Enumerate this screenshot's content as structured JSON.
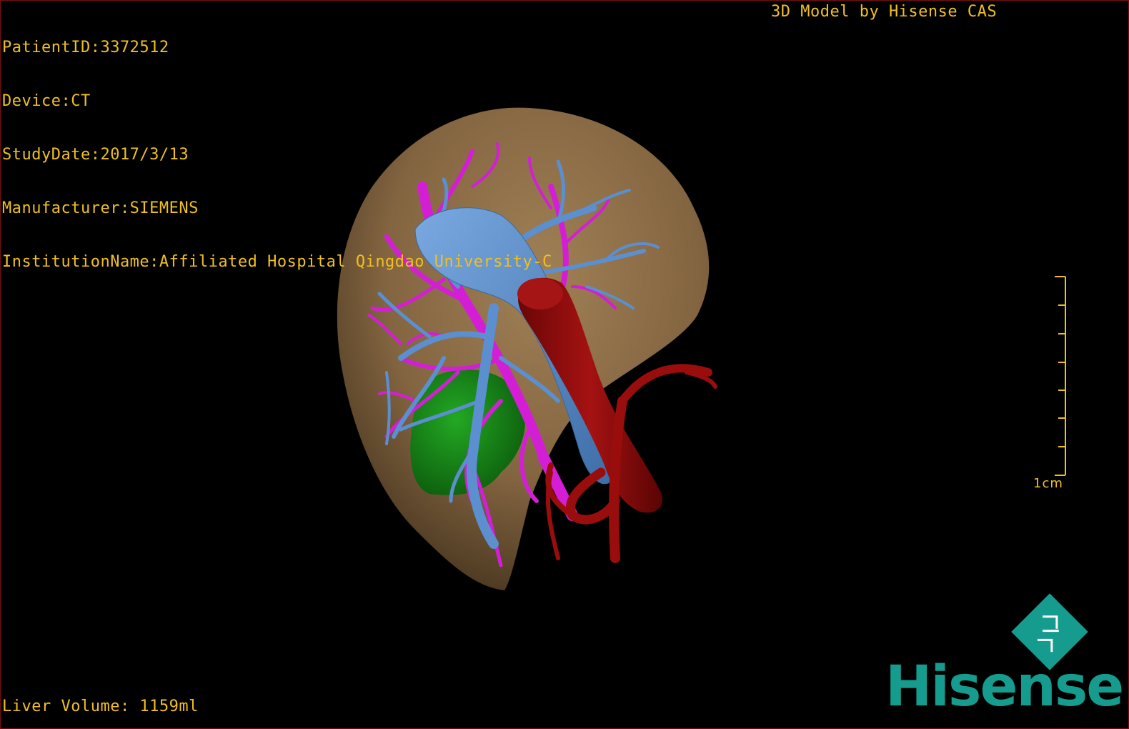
{
  "patient_info": {
    "patient_id": "PatientID:3372512",
    "device": "Device:CT",
    "study_date": "StudyDate:2017/3/13",
    "manufacturer": "Manufacturer:SIEMENS",
    "institution": "InstitutionName:Affiliated Hospital Qingdao University-C"
  },
  "model_credit": "3D Model by Hisense CAS",
  "liver_volume": "Liver Volume: 1159ml",
  "scale_bar": {
    "label": "1cm"
  },
  "logo": {
    "wordmark": "Hisense",
    "color": "#169c8e"
  },
  "colors": {
    "overlay_text": "#f0c020",
    "liver": "#8a6a44",
    "portal_vein": "#5b8fcf",
    "hepatic_vein": "#d41ed6",
    "artery": "#8e0a0a",
    "tumor": "#1a8a1a"
  }
}
